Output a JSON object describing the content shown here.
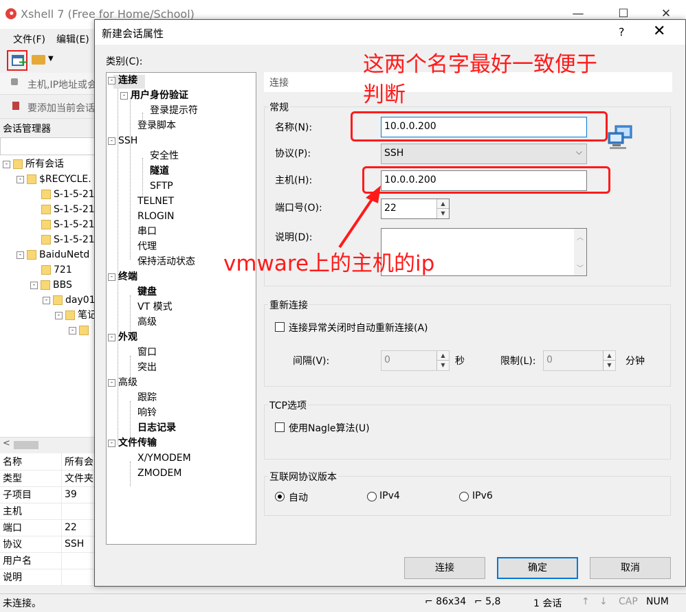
{
  "main_window": {
    "title": "Xshell 7 (Free for Home/School)",
    "controls": {
      "minimize": "—",
      "maximize": "☐",
      "close": "✕"
    },
    "menu": {
      "file": "文件(F)",
      "edit": "编辑(E)"
    },
    "address_placeholder": "主机,IP地址或会",
    "hint_text": "要添加当前会话",
    "session_manager_title": "会话管理器",
    "tree": [
      {
        "label": "所有会话",
        "expander": "-"
      },
      {
        "label": "$RECYCLE.",
        "expander": "-"
      },
      {
        "label": "S-1-5-21"
      },
      {
        "label": "S-1-5-21"
      },
      {
        "label": "S-1-5-21"
      },
      {
        "label": "S-1-5-21"
      },
      {
        "label": "BaiduNetd",
        "expander": "-"
      },
      {
        "label": "721"
      },
      {
        "label": "BBS",
        "expander": "-"
      },
      {
        "label": "day01",
        "expander": "-"
      },
      {
        "label": "笔记",
        "expander": "-"
      },
      {
        "label": ""
      }
    ],
    "scroll_left": "<",
    "properties": [
      {
        "key": "名称",
        "value": "所有会"
      },
      {
        "key": "类型",
        "value": "文件夹"
      },
      {
        "key": "子项目",
        "value": "39"
      },
      {
        "key": "主机",
        "value": ""
      },
      {
        "key": "端口",
        "value": "22"
      },
      {
        "key": "协议",
        "value": "SSH"
      },
      {
        "key": "用户名",
        "value": ""
      },
      {
        "key": "说明",
        "value": ""
      }
    ],
    "status": {
      "connection": "未连接。",
      "size": "⌐ 86x34",
      "cursor": "⌐ 5,8",
      "sessions": "1 会话",
      "up": "↑",
      "down": "↓",
      "cap": "CAP",
      "num": "NUM"
    }
  },
  "dialog": {
    "title": "新建会话属性",
    "help": "?",
    "close": "✕",
    "category_label": "类别(C):",
    "categories": [
      {
        "label": "连接",
        "bold": true,
        "expander": "-"
      },
      {
        "label": "用户身份验证",
        "bold": true,
        "expander": "-"
      },
      {
        "label": "登录提示符",
        "bold": false
      },
      {
        "label": "登录脚本",
        "bold": false
      },
      {
        "label": "SSH",
        "bold": false,
        "expander": "-"
      },
      {
        "label": "安全性",
        "bold": false
      },
      {
        "label": "隧道",
        "bold": true
      },
      {
        "label": "SFTP",
        "bold": false
      },
      {
        "label": "TELNET",
        "bold": false
      },
      {
        "label": "RLOGIN",
        "bold": false
      },
      {
        "label": "串口",
        "bold": false
      },
      {
        "label": "代理",
        "bold": false
      },
      {
        "label": "保持活动状态",
        "bold": false
      },
      {
        "label": "终端",
        "bold": true,
        "expander": "-"
      },
      {
        "label": "键盘",
        "bold": true
      },
      {
        "label": "VT 模式",
        "bold": false
      },
      {
        "label": "高级",
        "bold": false
      },
      {
        "label": "外观",
        "bold": true,
        "expander": "-"
      },
      {
        "label": "窗口",
        "bold": false
      },
      {
        "label": "突出",
        "bold": false
      },
      {
        "label": "高级",
        "bold": false,
        "expander": "-"
      },
      {
        "label": "跟踪",
        "bold": false
      },
      {
        "label": "响铃",
        "bold": false
      },
      {
        "label": "日志记录",
        "bold": true
      },
      {
        "label": "文件传输",
        "bold": true,
        "expander": "-"
      },
      {
        "label": "X/YMODEM",
        "bold": false
      },
      {
        "label": "ZMODEM",
        "bold": false
      }
    ],
    "section_title": "连接",
    "general": {
      "group_title": "常规",
      "name_label": "名称(N):",
      "name_value": "10.0.0.200",
      "protocol_label": "协议(P):",
      "protocol_value": "SSH",
      "host_label": "主机(H):",
      "host_value": "10.0.0.200",
      "port_label": "端口号(O):",
      "port_value": "22",
      "desc_label": "说明(D):",
      "desc_value": ""
    },
    "reconnect": {
      "group_title": "重新连接",
      "auto_label": "连接异常关闭时自动重新连接(A)",
      "interval_label": "间隔(V):",
      "interval_value": "0",
      "interval_unit": "秒",
      "limit_label": "限制(L):",
      "limit_value": "0",
      "limit_unit": "分钟"
    },
    "tcp": {
      "group_title": "TCP选项",
      "nagle_label": "使用Nagle算法(U)"
    },
    "ip_version": {
      "group_title": "互联网协议版本",
      "auto": "自动",
      "ipv4": "IPv4",
      "ipv6": "IPv6"
    },
    "buttons": {
      "connect": "连接",
      "ok": "确定",
      "cancel": "取消"
    },
    "arrows": {
      "up": "▲",
      "down": "▼",
      "combo": "⌵"
    }
  },
  "annotations": {
    "note_line1": "这两个名字最好一致便于",
    "note_line2": "判断",
    "host_note": "vmware上的主机的ip",
    "color": "#ff1a1a"
  },
  "colors": {
    "accent": "#0078d7",
    "annotation": "#ff1a1a",
    "folder": "#f8d775"
  }
}
